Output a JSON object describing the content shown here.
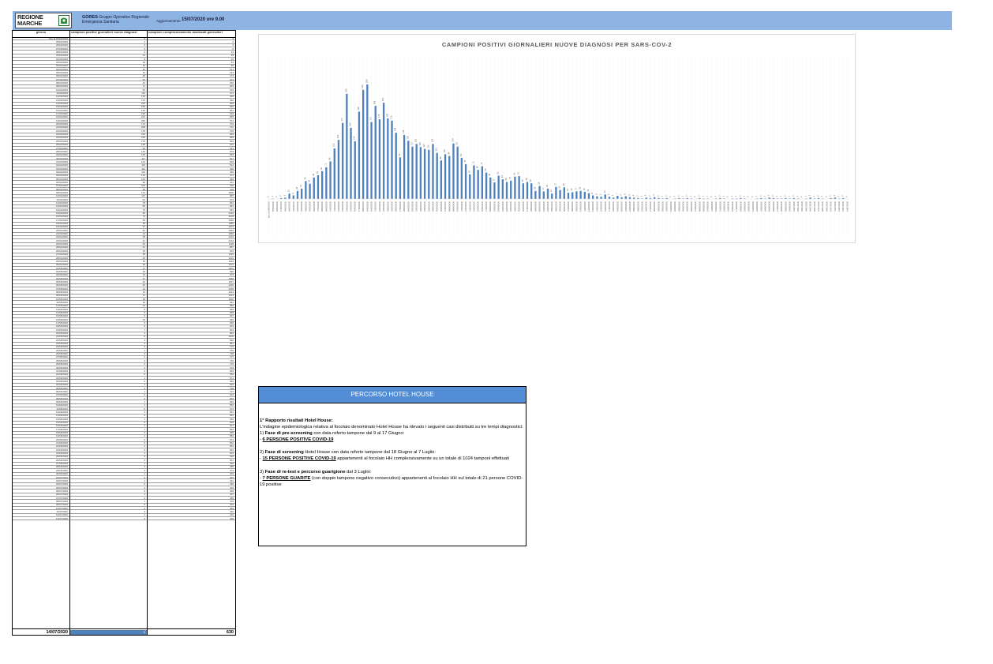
{
  "header": {
    "logo_text": "REGIONE\nMARCHE",
    "gores_name": "GORES",
    "gores_desc": "Gruppo Operativo Regionale Emergenza Sanitaria",
    "update_label": "Aggiornamento",
    "update_value": "15/07/2020 ore 9.00"
  },
  "table": {
    "header_day": "giorno",
    "header_new": "campioni positivi giornalieri nuove diagnosi",
    "header_total": "campioni complessivamente analizzati giornalieri",
    "rows": [
      [
        "fino al 24/02/2020",
        "0",
        "3"
      ],
      [
        "25/02/2020",
        "1",
        "2"
      ],
      [
        "26/02/2020",
        "0",
        "4"
      ],
      [
        "27/02/2020",
        "2",
        "6"
      ],
      [
        "28/02/2020",
        "3",
        "14"
      ],
      [
        "29/02/2020",
        "12",
        "38"
      ],
      [
        "01/03/2020",
        "8",
        "35"
      ],
      [
        "02/03/2020",
        "18",
        "61"
      ],
      [
        "03/03/2020",
        "23",
        "95"
      ],
      [
        "04/03/2020",
        "40",
        "121"
      ],
      [
        "05/03/2020",
        "34",
        "143"
      ],
      [
        "06/03/2020",
        "48",
        "170"
      ],
      [
        "07/03/2020",
        "53",
        "204"
      ],
      [
        "08/03/2020",
        "62",
        "236"
      ],
      [
        "09/03/2020",
        "71",
        "263"
      ],
      [
        "10/03/2020",
        "84",
        "315"
      ],
      [
        "11/03/2020",
        "113",
        "371"
      ],
      [
        "12/03/2020",
        "132",
        "408"
      ],
      [
        "13/03/2020",
        "170",
        "452"
      ],
      [
        "14/03/2020",
        "235",
        "508"
      ],
      [
        "15/03/2020",
        "159",
        "540"
      ],
      [
        "16/03/2020",
        "129",
        "581"
      ],
      [
        "17/03/2020",
        "195",
        "629"
      ],
      [
        "18/03/2020",
        "244",
        "655"
      ],
      [
        "19/03/2020",
        "256",
        "674"
      ],
      [
        "20/03/2020",
        "172",
        "702"
      ],
      [
        "21/03/2020",
        "208",
        "731"
      ],
      [
        "22/03/2020",
        "178",
        "709"
      ],
      [
        "23/03/2020",
        "215",
        "692"
      ],
      [
        "24/03/2020",
        "180",
        "668"
      ],
      [
        "25/03/2020",
        "175",
        "654"
      ],
      [
        "26/03/2020",
        "148",
        "632"
      ],
      [
        "27/03/2020",
        "93",
        "611"
      ],
      [
        "28/03/2020",
        "143",
        "579"
      ],
      [
        "29/03/2020",
        "130",
        "563"
      ],
      [
        "30/03/2020",
        "117",
        "547"
      ],
      [
        "31/03/2020",
        "123",
        "528"
      ],
      [
        "01/04/2020",
        "116",
        "512"
      ],
      [
        "02/04/2020",
        "112",
        "499"
      ],
      [
        "03/04/2020",
        "110",
        "486"
      ],
      [
        "04/04/2020",
        "123",
        "471"
      ],
      [
        "05/04/2020",
        "103",
        "456"
      ],
      [
        "06/04/2020",
        "86",
        "441"
      ],
      [
        "07/04/2020",
        "100",
        "430"
      ],
      [
        "08/04/2020",
        "96",
        "418"
      ],
      [
        "09/04/2020",
        "124",
        "1000"
      ],
      [
        "10/04/2020",
        "117",
        "987"
      ],
      [
        "11/04/2020",
        "92",
        "973"
      ],
      [
        "12/04/2020",
        "78",
        "962"
      ],
      [
        "13/04/2020",
        "55",
        "951"
      ],
      [
        "14/04/2020",
        "75",
        "940"
      ],
      [
        "15/04/2020",
        "65",
        "1120"
      ],
      [
        "16/04/2020",
        "73",
        "1108"
      ],
      [
        "17/04/2020",
        "59",
        "1096"
      ],
      [
        "18/04/2020",
        "48",
        "1085"
      ],
      [
        "19/04/2020",
        "37",
        "1074"
      ],
      [
        "20/04/2020",
        "52",
        "1063"
      ],
      [
        "21/04/2020",
        "44",
        "1052"
      ],
      [
        "22/04/2020",
        "38",
        "1140"
      ],
      [
        "23/04/2020",
        "41",
        "1129"
      ],
      [
        "24/04/2020",
        "50",
        "1118"
      ],
      [
        "25/04/2020",
        "51",
        "887"
      ],
      [
        "26/04/2020",
        "35",
        "876"
      ],
      [
        "27/04/2020",
        "38",
        "1045"
      ],
      [
        "28/04/2020",
        "35",
        "1234"
      ],
      [
        "29/04/2020",
        "18",
        "1223"
      ],
      [
        "30/04/2020",
        "29",
        "1212"
      ],
      [
        "01/05/2020",
        "17",
        "1001"
      ],
      [
        "02/05/2020",
        "23",
        "990"
      ],
      [
        "03/05/2020",
        "12",
        "979"
      ],
      [
        "04/05/2020",
        "27",
        "1068"
      ],
      [
        "05/05/2020",
        "20",
        "1257"
      ],
      [
        "06/05/2020",
        "26",
        "1246"
      ],
      [
        "07/05/2020",
        "14",
        "1235"
      ],
      [
        "08/05/2020",
        "15",
        "1224"
      ],
      [
        "09/05/2020",
        "17",
        "1013"
      ],
      [
        "10/05/2020",
        "18",
        "1002"
      ],
      [
        "11/05/2020",
        "16",
        "991"
      ],
      [
        "12/05/2020",
        "13",
        "980"
      ],
      [
        "13/05/2020",
        "8",
        "969"
      ],
      [
        "14/05/2020",
        "6",
        "958"
      ],
      [
        "15/05/2020",
        "5",
        "947"
      ],
      [
        "16/05/2020",
        "10",
        "936"
      ],
      [
        "17/05/2020",
        "5",
        "925"
      ],
      [
        "18/05/2020",
        "3",
        "914"
      ],
      [
        "19/05/2020",
        "7",
        "903"
      ],
      [
        "20/05/2020",
        "4",
        "892"
      ],
      [
        "21/05/2020",
        "6",
        "1003"
      ],
      [
        "22/05/2020",
        "4",
        "992"
      ],
      [
        "23/05/2020",
        "3",
        "981"
      ],
      [
        "24/05/2020",
        "2",
        "770"
      ],
      [
        "25/05/2020",
        "1",
        "759"
      ],
      [
        "26/05/2020",
        "3",
        "748"
      ],
      [
        "27/05/2020",
        "2",
        "737"
      ],
      [
        "28/05/2020",
        "4",
        "726"
      ],
      [
        "29/05/2020",
        "2",
        "715"
      ],
      [
        "30/05/2020",
        "1",
        "704"
      ],
      [
        "31/05/2020",
        "2",
        "593"
      ],
      [
        "01/06/2020",
        "0",
        "582"
      ],
      [
        "02/06/2020",
        "1",
        "571"
      ],
      [
        "03/06/2020",
        "2",
        "560"
      ],
      [
        "04/06/2020",
        "1",
        "549"
      ],
      [
        "05/06/2020",
        "2",
        "738"
      ],
      [
        "06/06/2020",
        "1",
        "727"
      ],
      [
        "07/06/2020",
        "0",
        "616"
      ],
      [
        "08/06/2020",
        "2",
        "605"
      ],
      [
        "09/06/2020",
        "1",
        "594"
      ],
      [
        "10/06/2020",
        "1",
        "583"
      ],
      [
        "11/06/2020",
        "0",
        "572"
      ],
      [
        "12/06/2020",
        "1",
        "561"
      ],
      [
        "13/06/2020",
        "2",
        "550"
      ],
      [
        "14/06/2020",
        "1",
        "539"
      ],
      [
        "15/06/2020",
        "0",
        "528"
      ],
      [
        "16/06/2020",
        "1",
        "517"
      ],
      [
        "17/06/2020",
        "1",
        "506"
      ],
      [
        "18/06/2020",
        "2",
        "495"
      ],
      [
        "19/06/2020",
        "1",
        "584"
      ],
      [
        "20/06/2020",
        "0",
        "573"
      ],
      [
        "21/06/2020",
        "0",
        "562"
      ],
      [
        "22/06/2020",
        "1",
        "551"
      ],
      [
        "23/06/2020",
        "2",
        "540"
      ],
      [
        "24/06/2020",
        "1",
        "529"
      ],
      [
        "25/06/2020",
        "3",
        "518"
      ],
      [
        "26/06/2020",
        "2",
        "507"
      ],
      [
        "27/06/2020",
        "1",
        "496"
      ],
      [
        "28/06/2020",
        "1",
        "485"
      ],
      [
        "29/06/2020",
        "2",
        "474"
      ],
      [
        "30/06/2020",
        "1",
        "463"
      ],
      [
        "01/07/2020",
        "2",
        "452"
      ],
      [
        "02/07/2020",
        "1",
        "441"
      ],
      [
        "03/07/2020",
        "0",
        "430"
      ],
      [
        "04/07/2020",
        "1",
        "419"
      ],
      [
        "05/07/2020",
        "3",
        "408"
      ],
      [
        "06/07/2020",
        "1",
        "497"
      ],
      [
        "07/07/2020",
        "2",
        "486"
      ],
      [
        "08/07/2020",
        "1",
        "475"
      ],
      [
        "09/07/2020",
        "0",
        "464"
      ],
      [
        "10/07/2020",
        "2",
        "453"
      ],
      [
        "11/07/2020",
        "3",
        "442"
      ],
      [
        "12/07/2020",
        "1",
        "431"
      ],
      [
        "13/07/2020",
        "2",
        "420"
      ]
    ],
    "total_date": "14/07/2020",
    "total_new": "0",
    "total_total": "630"
  },
  "chart_data": {
    "type": "bar",
    "title": "CAMPIONI POSITIVI GIORNALIERI NUOVE DIAGNOSI PER SARS-COV-2",
    "categories": [
      "fino al 24/02/2020",
      "25/02/2020",
      "26/02/2020",
      "27/02/2020",
      "28/02/2020",
      "29/02/2020",
      "01/03/2020",
      "02/03/2020",
      "03/03/2020",
      "04/03/2020",
      "05/03/2020",
      "06/03/2020",
      "07/03/2020",
      "08/03/2020",
      "09/03/2020",
      "10/03/2020",
      "11/03/2020",
      "12/03/2020",
      "13/03/2020",
      "14/03/2020",
      "15/03/2020",
      "16/03/2020",
      "17/03/2020",
      "18/03/2020",
      "19/03/2020",
      "20/03/2020",
      "21/03/2020",
      "22/03/2020",
      "23/03/2020",
      "24/03/2020",
      "25/03/2020",
      "26/03/2020",
      "27/03/2020",
      "28/03/2020",
      "29/03/2020",
      "30/03/2020",
      "31/03/2020",
      "01/04/2020",
      "02/04/2020",
      "03/04/2020",
      "04/04/2020",
      "05/04/2020",
      "06/04/2020",
      "07/04/2020",
      "08/04/2020",
      "09/04/2020",
      "10/04/2020",
      "11/04/2020",
      "12/04/2020",
      "13/04/2020",
      "14/04/2020",
      "15/04/2020",
      "16/04/2020",
      "17/04/2020",
      "18/04/2020",
      "19/04/2020",
      "20/04/2020",
      "21/04/2020",
      "22/04/2020",
      "23/04/2020",
      "24/04/2020",
      "25/04/2020",
      "26/04/2020",
      "27/04/2020",
      "28/04/2020",
      "29/04/2020",
      "30/04/2020",
      "01/05/2020",
      "02/05/2020",
      "03/05/2020",
      "04/05/2020",
      "05/05/2020",
      "06/05/2020",
      "07/05/2020",
      "08/05/2020",
      "09/05/2020",
      "10/05/2020",
      "11/05/2020",
      "12/05/2020",
      "13/05/2020",
      "14/05/2020",
      "15/05/2020",
      "16/05/2020",
      "17/05/2020",
      "18/05/2020",
      "19/05/2020",
      "20/05/2020",
      "21/05/2020",
      "22/05/2020",
      "23/05/2020",
      "24/05/2020",
      "25/05/2020",
      "26/05/2020",
      "27/05/2020",
      "28/05/2020",
      "29/05/2020",
      "30/05/2020",
      "31/05/2020",
      "01/06/2020",
      "02/06/2020",
      "03/06/2020",
      "04/06/2020",
      "05/06/2020",
      "06/06/2020",
      "07/06/2020",
      "08/06/2020",
      "09/06/2020",
      "10/06/2020",
      "11/06/2020",
      "12/06/2020",
      "13/06/2020",
      "14/06/2020",
      "15/06/2020",
      "16/06/2020",
      "17/06/2020",
      "18/06/2020",
      "19/06/2020",
      "20/06/2020",
      "21/06/2020",
      "22/06/2020",
      "23/06/2020",
      "24/06/2020",
      "25/06/2020",
      "26/06/2020",
      "27/06/2020",
      "28/06/2020",
      "29/06/2020",
      "30/06/2020",
      "01/07/2020",
      "02/07/2020",
      "03/07/2020",
      "04/07/2020",
      "05/07/2020",
      "06/07/2020",
      "07/07/2020",
      "08/07/2020",
      "09/07/2020",
      "10/07/2020",
      "11/07/2020",
      "12/07/2020",
      "13/07/2020",
      "14/07/2020"
    ],
    "values": [
      0,
      1,
      0,
      2,
      3,
      12,
      8,
      18,
      23,
      40,
      34,
      48,
      53,
      62,
      71,
      84,
      113,
      132,
      170,
      235,
      159,
      129,
      195,
      244,
      256,
      172,
      208,
      178,
      215,
      180,
      175,
      148,
      93,
      143,
      130,
      117,
      123,
      116,
      112,
      110,
      123,
      103,
      86,
      100,
      96,
      124,
      117,
      92,
      78,
      55,
      75,
      65,
      73,
      59,
      48,
      37,
      52,
      44,
      38,
      41,
      50,
      51,
      35,
      38,
      35,
      18,
      29,
      17,
      23,
      12,
      27,
      20,
      26,
      14,
      15,
      17,
      18,
      16,
      13,
      8,
      6,
      5,
      10,
      5,
      3,
      7,
      4,
      6,
      4,
      3,
      2,
      1,
      3,
      2,
      4,
      2,
      1,
      2,
      0,
      1,
      2,
      1,
      2,
      1,
      0,
      2,
      1,
      1,
      0,
      1,
      2,
      1,
      0,
      1,
      1,
      2,
      1,
      0,
      0,
      1,
      2,
      1,
      3,
      2,
      1,
      1,
      2,
      1,
      2,
      1,
      0,
      1,
      3,
      1,
      2,
      1,
      0,
      2,
      3,
      1,
      2,
      0
    ],
    "ylim": [
      0,
      300
    ],
    "grid": true,
    "bar_color": "#4f81bd"
  },
  "hotel_house": {
    "title": "PERCORSO HOTEL HOUSE",
    "report_title": "1° Rapporto  risultati Hotel House:",
    "intro": "L'indagine epidemiologica relativa al focolaio denominato Hotel House ha rilevato i seguenti casi distribuiti su tre tempi diagnostici:",
    "phase1_title": "Fase di pre-screening",
    "phase1_text": " con data referto tampone dal 9 al 17 Giugno:",
    "phase1_result": "6 PERSONE POSITIVE COVID-19",
    "phase2_title": "Fase di screening",
    "phase2_text": " Hotel House con data referto tampone dal 18 Giugno al 7 Luglio:",
    "phase2_result": "15 PERSONE POSITIVE COVID-19",
    "phase2_tail": " appartenenti al focolaio HH complessivamente su un totale di 1024 tamponi effettuati",
    "phase3_title": "Fase di re-test e percorso guarigione",
    "phase3_text": " dal 3 Luglio:",
    "phase3_result": "7 PERSONE GUARITE",
    "phase3_tail": " (con doppio tampone negativo consecutivo) appartenenti al focolaio HH sul totale di 21 persone COVID-19 positive"
  }
}
